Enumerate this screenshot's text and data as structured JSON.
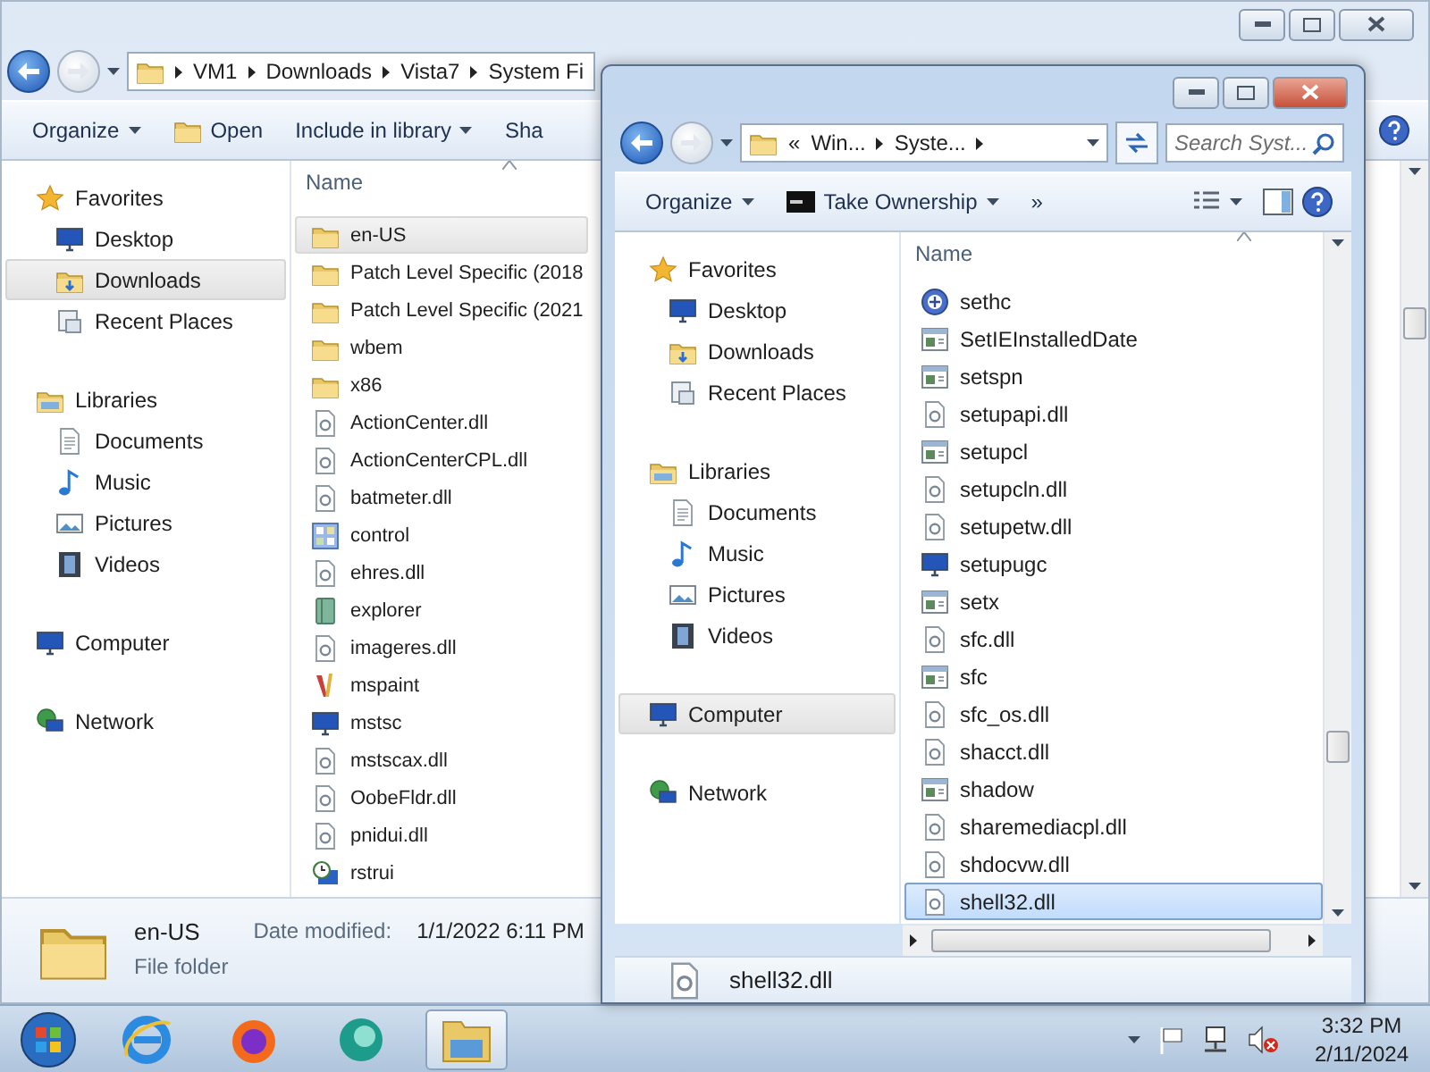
{
  "back_window": {
    "active": false,
    "address": {
      "crumbs": [
        "VM1",
        "Downloads",
        "Vista7",
        "System Fi"
      ]
    },
    "toolbar": [
      {
        "label": "Organize",
        "kind": "menu"
      },
      {
        "label": "Open",
        "kind": "open"
      },
      {
        "label": "Include in library",
        "kind": "menu"
      },
      {
        "label": "Sha",
        "kind": "plain"
      }
    ],
    "nav": [
      {
        "label": "Favorites",
        "kind": "star",
        "selected": false,
        "children": [
          {
            "label": "Desktop",
            "kind": "desktop",
            "selected": false
          },
          {
            "label": "Downloads",
            "kind": "downloads",
            "selected": true
          },
          {
            "label": "Recent Places",
            "kind": "recent",
            "selected": false
          }
        ]
      },
      {
        "label": "Libraries",
        "kind": "library",
        "selected": false,
        "children": [
          {
            "label": "Documents",
            "kind": "documents",
            "selected": false
          },
          {
            "label": "Music",
            "kind": "music",
            "selected": false
          },
          {
            "label": "Pictures",
            "kind": "pictures",
            "selected": false
          },
          {
            "label": "Videos",
            "kind": "videos",
            "selected": false
          }
        ]
      },
      {
        "label": "Computer",
        "kind": "computer",
        "selected": false
      },
      {
        "label": "Network",
        "kind": "network",
        "selected": false
      }
    ],
    "column": "Name",
    "files": [
      {
        "name": "en-US",
        "kind": "folder",
        "selected": true
      },
      {
        "name": "Patch Level Specific (2018",
        "kind": "folder",
        "selected": false
      },
      {
        "name": "Patch Level Specific (2021",
        "kind": "folder",
        "selected": false
      },
      {
        "name": "wbem",
        "kind": "folder",
        "selected": false
      },
      {
        "name": "x86",
        "kind": "folder",
        "selected": false
      },
      {
        "name": "ActionCenter.dll",
        "kind": "dll",
        "selected": false
      },
      {
        "name": "ActionCenterCPL.dll",
        "kind": "dll",
        "selected": false
      },
      {
        "name": "batmeter.dll",
        "kind": "dll",
        "selected": false
      },
      {
        "name": "control",
        "kind": "control",
        "selected": false
      },
      {
        "name": "ehres.dll",
        "kind": "dll",
        "selected": false
      },
      {
        "name": "explorer",
        "kind": "book",
        "selected": false
      },
      {
        "name": "imageres.dll",
        "kind": "dll",
        "selected": false
      },
      {
        "name": "mspaint",
        "kind": "brush",
        "selected": false
      },
      {
        "name": "mstsc",
        "kind": "monitor",
        "selected": false
      },
      {
        "name": "mstscax.dll",
        "kind": "dll",
        "selected": false
      },
      {
        "name": "OobeFldr.dll",
        "kind": "dll",
        "selected": false
      },
      {
        "name": "pnidui.dll",
        "kind": "dll",
        "selected": false
      },
      {
        "name": "rstrui",
        "kind": "clock",
        "selected": false
      }
    ],
    "details": {
      "name": "en-US",
      "label": "Date modified:",
      "value": "1/1/2022 6:11 PM",
      "type": "File folder"
    }
  },
  "front_window": {
    "active": true,
    "address": {
      "overflow": "«",
      "crumbs": [
        "Win...",
        "Syste..."
      ]
    },
    "search": {
      "placeholder": "Search Syst..."
    },
    "toolbar": [
      {
        "label": "Organize",
        "kind": "menu"
      },
      {
        "label": "Take Ownership",
        "kind": "command"
      },
      {
        "label": "»",
        "kind": "more"
      }
    ],
    "nav": [
      {
        "label": "Favorites",
        "kind": "star",
        "selected": false,
        "children": [
          {
            "label": "Desktop",
            "kind": "desktop",
            "selected": false
          },
          {
            "label": "Downloads",
            "kind": "downloads",
            "selected": false
          },
          {
            "label": "Recent Places",
            "kind": "recent",
            "selected": false
          }
        ]
      },
      {
        "label": "Libraries",
        "kind": "library",
        "selected": false,
        "children": [
          {
            "label": "Documents",
            "kind": "documents",
            "selected": false
          },
          {
            "label": "Music",
            "kind": "music",
            "selected": false
          },
          {
            "label": "Pictures",
            "kind": "pictures",
            "selected": false
          },
          {
            "label": "Videos",
            "kind": "videos",
            "selected": false
          }
        ]
      },
      {
        "label": "Computer",
        "kind": "computer",
        "selected": true
      },
      {
        "label": "Network",
        "kind": "network",
        "selected": false
      }
    ],
    "column": "Name",
    "files": [
      {
        "name": "sethc",
        "kind": "emblem",
        "selected": false
      },
      {
        "name": "SetIEInstalledDate",
        "kind": "app",
        "selected": false
      },
      {
        "name": "setspn",
        "kind": "app",
        "selected": false
      },
      {
        "name": "setupapi.dll",
        "kind": "dll",
        "selected": false
      },
      {
        "name": "setupcl",
        "kind": "app",
        "selected": false
      },
      {
        "name": "setupcln.dll",
        "kind": "dll",
        "selected": false
      },
      {
        "name": "setupetw.dll",
        "kind": "dll",
        "selected": false
      },
      {
        "name": "setupugc",
        "kind": "monitor",
        "selected": false
      },
      {
        "name": "setx",
        "kind": "app",
        "selected": false
      },
      {
        "name": "sfc.dll",
        "kind": "dll",
        "selected": false
      },
      {
        "name": "sfc",
        "kind": "app",
        "selected": false
      },
      {
        "name": "sfc_os.dll",
        "kind": "dll",
        "selected": false
      },
      {
        "name": "shacct.dll",
        "kind": "dll",
        "selected": false
      },
      {
        "name": "shadow",
        "kind": "app",
        "selected": false
      },
      {
        "name": "sharemediacpl.dll",
        "kind": "dll",
        "selected": false
      },
      {
        "name": "shdocvw.dll",
        "kind": "dll",
        "selected": false
      },
      {
        "name": "shell32.dll",
        "kind": "dll",
        "selected": true
      }
    ],
    "details": {
      "name": "shell32.dll"
    }
  },
  "taskbar": {
    "apps": [
      {
        "kind": "ie",
        "active": false
      },
      {
        "kind": "firefox",
        "active": false
      },
      {
        "kind": "swirl",
        "active": false
      },
      {
        "kind": "explorer",
        "active": true
      }
    ],
    "clock": {
      "time": "3:32 PM",
      "date": "2/11/2024"
    }
  }
}
